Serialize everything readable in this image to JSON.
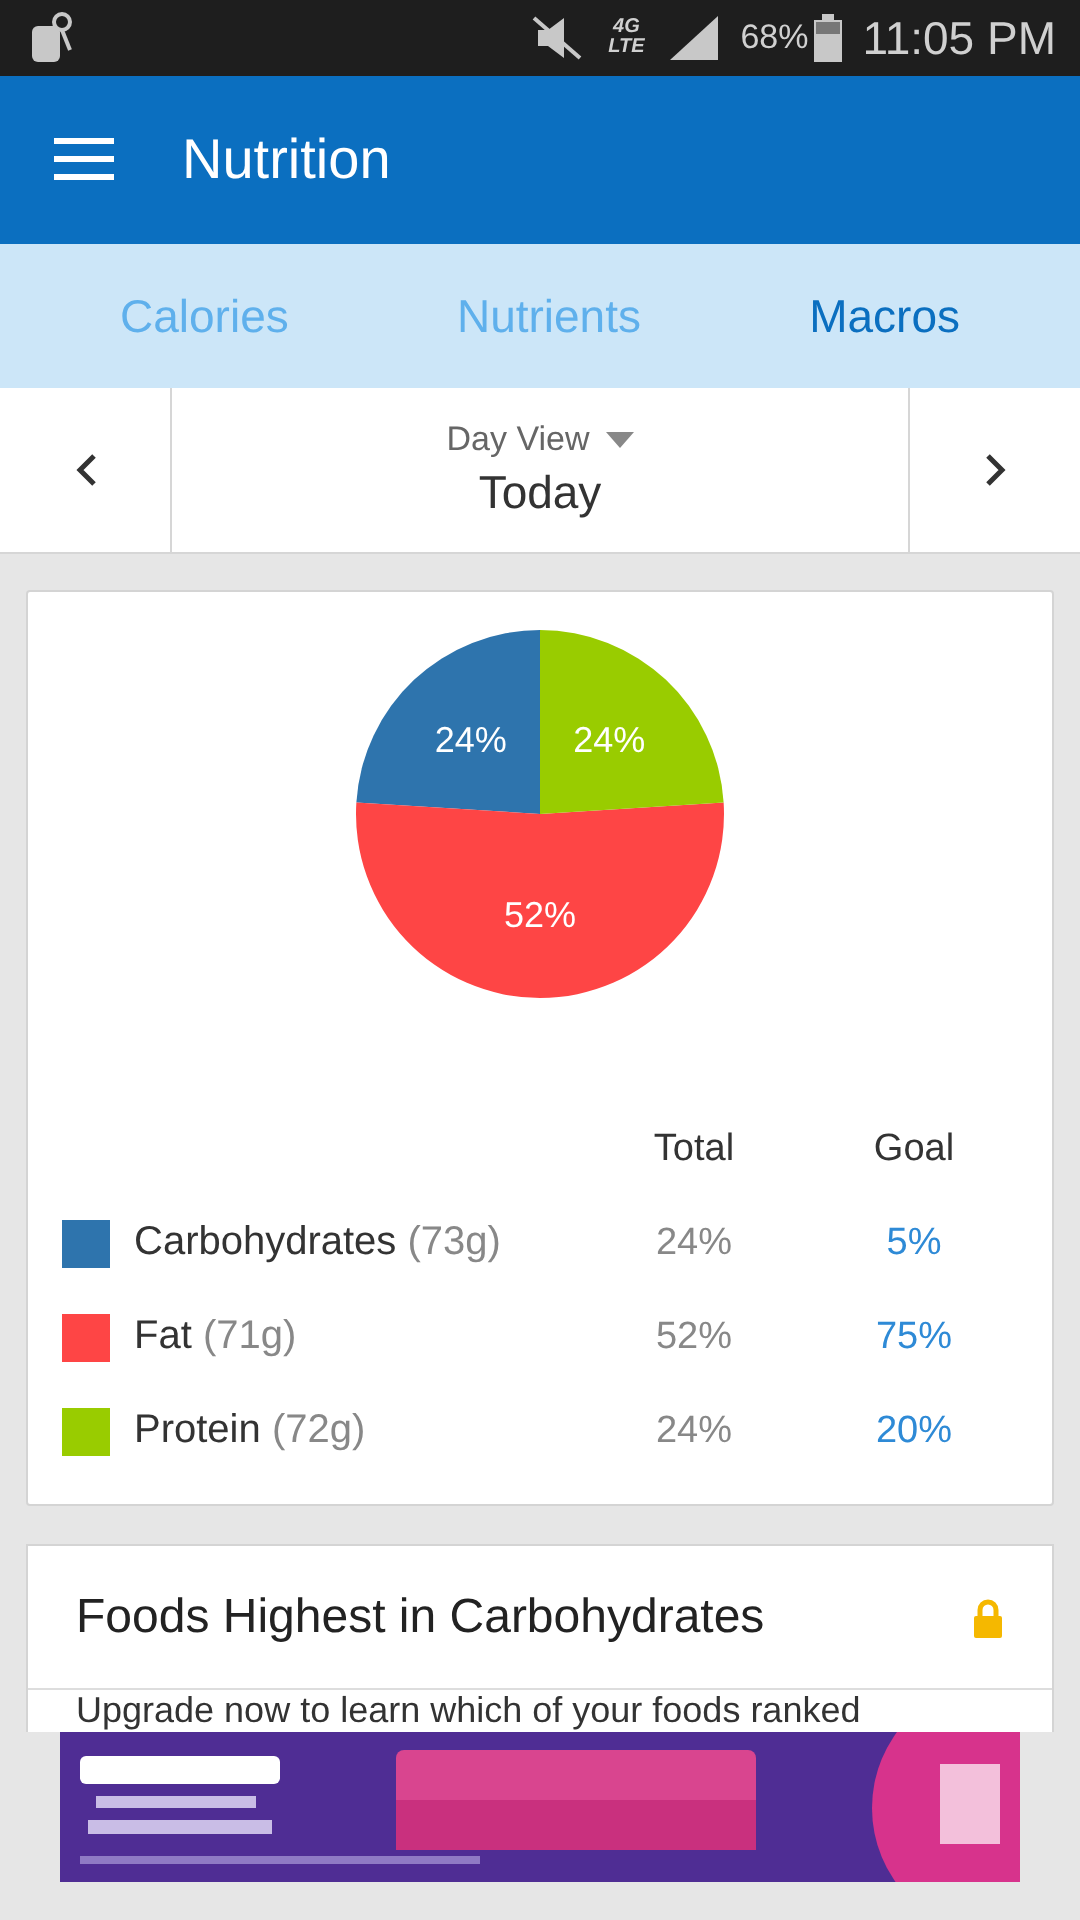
{
  "status_bar": {
    "network": "4G LTE",
    "battery": "68%",
    "time": "11:05 PM"
  },
  "app_bar": {
    "title": "Nutrition"
  },
  "tabs": [
    {
      "label": "Calories",
      "selected": false
    },
    {
      "label": "Nutrients",
      "selected": false
    },
    {
      "label": "Macros",
      "selected": true
    }
  ],
  "date_nav": {
    "view": "Day View",
    "date": "Today"
  },
  "macros": {
    "chart_data": {
      "type": "pie",
      "categories": [
        "Carbohydrates",
        "Fat",
        "Protein"
      ],
      "series": [
        {
          "values": [
            24,
            52,
            24
          ]
        }
      ]
    },
    "slice_labels": [
      "24%",
      "52%",
      "24%"
    ],
    "columns": [
      "Total",
      "Goal"
    ],
    "rows": [
      {
        "grams": "(73g)",
        "total": "24%",
        "goal": "5%",
        "color": "#2e74ad"
      },
      {
        "grams": "(71g)",
        "total": "52%",
        "goal": "75%",
        "color": "#fe4545"
      },
      {
        "grams": "(72g)",
        "total": "24%",
        "goal": "20%",
        "color": "#99cc00"
      }
    ]
  },
  "foods_card": {
    "title": "Foods Highest in Carbohydrates",
    "locked": true,
    "text": "Upgrade now to learn which of your foods ranked"
  }
}
